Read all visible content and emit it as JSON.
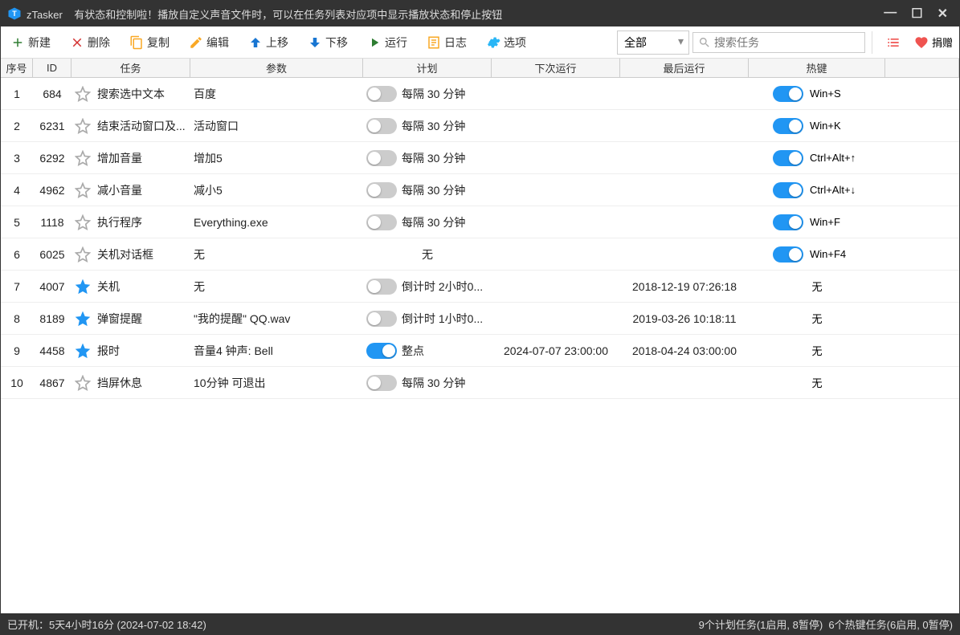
{
  "titlebar": {
    "app_name": "zTasker",
    "announcement": "有状态和控制啦！播放自定义声音文件时，可以在任务列表对应项中显示播放状态和停止按钮"
  },
  "toolbar": {
    "new": "新建",
    "delete": "删除",
    "copy": "复制",
    "edit": "编辑",
    "move_up": "上移",
    "move_down": "下移",
    "run": "运行",
    "log": "日志",
    "options": "选项",
    "filter_selected": "全部",
    "search_placeholder": "搜索任务",
    "donate": "捐赠"
  },
  "columns": {
    "seq": "序号",
    "id": "ID",
    "task": "任务",
    "param": "参数",
    "plan": "计划",
    "next": "下次运行",
    "last": "最后运行",
    "hotkey": "热键"
  },
  "rows": [
    {
      "seq": "1",
      "id": "684",
      "starred": false,
      "task": "搜索选中文本",
      "param": "百度",
      "plan_on": false,
      "plan": "每隔 30 分钟",
      "next": "",
      "last": "",
      "hotkey_on": true,
      "hotkey": "Win+S"
    },
    {
      "seq": "2",
      "id": "6231",
      "starred": false,
      "task": "结束活动窗口及...",
      "param": "活动窗口",
      "plan_on": false,
      "plan": "每隔 30 分钟",
      "next": "",
      "last": "",
      "hotkey_on": true,
      "hotkey": "Win+K"
    },
    {
      "seq": "3",
      "id": "6292",
      "starred": false,
      "task": "增加音量",
      "param": "增加5",
      "plan_on": false,
      "plan": "每隔 30 分钟",
      "next": "",
      "last": "",
      "hotkey_on": true,
      "hotkey": "Ctrl+Alt+↑"
    },
    {
      "seq": "4",
      "id": "4962",
      "starred": false,
      "task": "减小音量",
      "param": "减小5",
      "plan_on": false,
      "plan": "每隔 30 分钟",
      "next": "",
      "last": "",
      "hotkey_on": true,
      "hotkey": "Ctrl+Alt+↓"
    },
    {
      "seq": "5",
      "id": "1118",
      "starred": false,
      "task": "执行程序",
      "param": "Everything.exe",
      "plan_on": false,
      "plan": "每隔 30 分钟",
      "next": "",
      "last": "",
      "hotkey_on": true,
      "hotkey": "Win+F"
    },
    {
      "seq": "6",
      "id": "6025",
      "starred": false,
      "task": "关机对话框",
      "param": "无",
      "plan_on": null,
      "plan": "无",
      "next": "",
      "last": "",
      "hotkey_on": true,
      "hotkey": "Win+F4"
    },
    {
      "seq": "7",
      "id": "4007",
      "starred": true,
      "task": "关机",
      "param": "无",
      "plan_on": false,
      "plan": "倒计时 2小时0...",
      "next": "",
      "last": "2018-12-19 07:26:18",
      "hotkey_on": null,
      "hotkey": "无"
    },
    {
      "seq": "8",
      "id": "8189",
      "starred": true,
      "task": "弹窗提醒",
      "param": "\"我的提醒\" QQ.wav",
      "plan_on": false,
      "plan": "倒计时 1小时0...",
      "next": "",
      "last": "2019-03-26 10:18:11",
      "hotkey_on": null,
      "hotkey": "无"
    },
    {
      "seq": "9",
      "id": "4458",
      "starred": true,
      "task": "报时",
      "param": "音量4 钟声: Bell",
      "plan_on": true,
      "plan": "整点",
      "next": "2024-07-07 23:00:00",
      "last": "2018-04-24 03:00:00",
      "hotkey_on": null,
      "hotkey": "无"
    },
    {
      "seq": "10",
      "id": "4867",
      "starred": false,
      "task": "挡屏休息",
      "param": "10分钟 可退出",
      "plan_on": false,
      "plan": "每隔 30 分钟",
      "next": "",
      "last": "",
      "hotkey_on": null,
      "hotkey": "无"
    }
  ],
  "statusbar": {
    "uptime": "已开机：5天4小时16分 (2024-07-02 18:42)",
    "plan_summary": "9个计划任务(1启用, 8暂停)",
    "hotkey_summary": "6个热键任务(6启用, 0暂停)"
  }
}
